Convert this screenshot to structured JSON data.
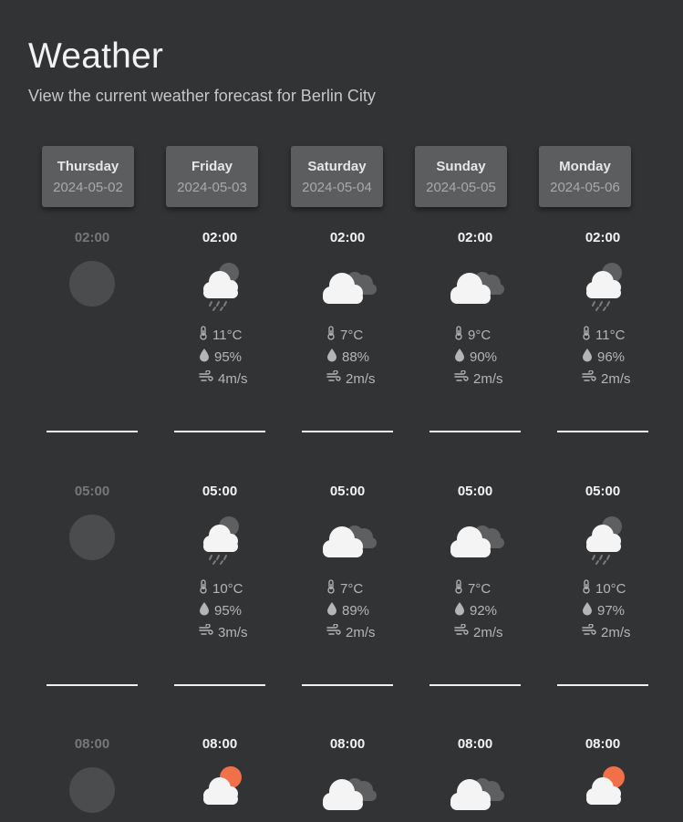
{
  "header": {
    "title": "Weather",
    "subtitle": "View the current weather forecast for Berlin City"
  },
  "colors": {
    "background": "#313335",
    "card": "#5c5d5e",
    "sun": "#f0704a",
    "cloud": "#f4f4f4"
  },
  "days": [
    {
      "name": "Thursday",
      "date": "2024-05-02"
    },
    {
      "name": "Friday",
      "date": "2024-05-03"
    },
    {
      "name": "Saturday",
      "date": "2024-05-04"
    },
    {
      "name": "Sunday",
      "date": "2024-05-05"
    },
    {
      "name": "Monday",
      "date": "2024-05-06"
    }
  ],
  "forecast": [
    [
      {
        "time": "02:00",
        "icon": "unavailable-icon"
      },
      {
        "time": "05:00",
        "icon": "unavailable-icon"
      },
      {
        "time": "08:00",
        "icon": "unavailable-icon"
      }
    ],
    [
      {
        "time": "02:00",
        "icon": "cloud-rain-icon",
        "temp": "11°C",
        "humidity": "95%",
        "wind": "4m/s"
      },
      {
        "time": "05:00",
        "icon": "cloud-rain-icon",
        "temp": "10°C",
        "humidity": "95%",
        "wind": "3m/s"
      },
      {
        "time": "08:00",
        "icon": "sun-cloud-icon"
      }
    ],
    [
      {
        "time": "02:00",
        "icon": "clouds-icon",
        "temp": "7°C",
        "humidity": "88%",
        "wind": "2m/s"
      },
      {
        "time": "05:00",
        "icon": "clouds-icon",
        "temp": "7°C",
        "humidity": "89%",
        "wind": "2m/s"
      },
      {
        "time": "08:00",
        "icon": "clouds-icon"
      }
    ],
    [
      {
        "time": "02:00",
        "icon": "clouds-icon",
        "temp": "9°C",
        "humidity": "90%",
        "wind": "2m/s"
      },
      {
        "time": "05:00",
        "icon": "clouds-icon",
        "temp": "7°C",
        "humidity": "92%",
        "wind": "2m/s"
      },
      {
        "time": "08:00",
        "icon": "clouds-icon"
      }
    ],
    [
      {
        "time": "02:00",
        "icon": "cloud-rain-icon",
        "temp": "11°C",
        "humidity": "96%",
        "wind": "2m/s"
      },
      {
        "time": "05:00",
        "icon": "cloud-rain-icon",
        "temp": "10°C",
        "humidity": "97%",
        "wind": "2m/s"
      },
      {
        "time": "08:00",
        "icon": "sun-cloud-icon"
      }
    ]
  ]
}
